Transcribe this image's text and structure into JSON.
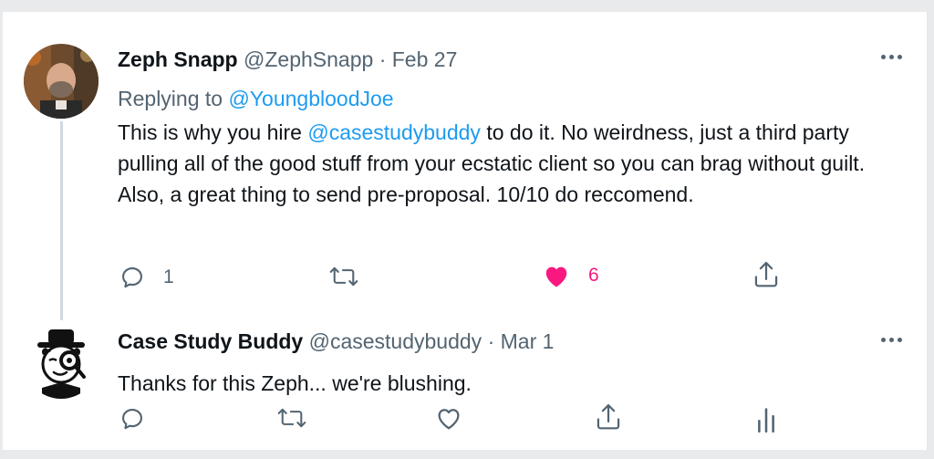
{
  "tweets": [
    {
      "name": "Zeph Snapp",
      "handle": "@ZephSnapp",
      "separator": "·",
      "date": "Feb 27",
      "replying_prefix": "Replying to ",
      "replying_to": "@YoungbloodJoe",
      "text_before_mention": "This is why you hire ",
      "mention": "@casestudybuddy",
      "text_after_mention": " to do it. No weirdness, just a third party pulling all of the good stuff from your ecstatic client so you can brag without guilt. Also, a great thing to send pre-proposal. 10/10 do reccomend.",
      "reply_count": "1",
      "like_count": "6",
      "liked": true
    },
    {
      "name": "Case Study Buddy",
      "handle": "@casestudybuddy",
      "separator": "·",
      "date": "Mar 1",
      "text": "Thanks for this Zeph... we're blushing."
    }
  ],
  "icons": {
    "reply": "reply-icon",
    "retweet": "retweet-icon",
    "like": "heart-icon",
    "share": "share-icon",
    "analytics": "analytics-icon",
    "more": "more-icon"
  },
  "colors": {
    "like_active": "#f91880",
    "link": "#1d9bf0",
    "secondary_text": "#536471"
  }
}
